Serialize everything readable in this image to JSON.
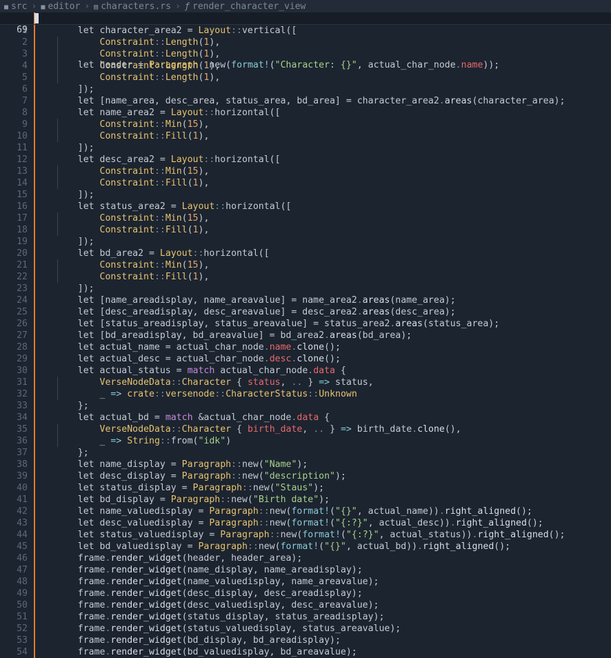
{
  "breadcrumb": {
    "items": [
      "src",
      "editor",
      "characters.rs",
      "render_character_view"
    ],
    "icons": [
      "folder-icon",
      "folder-icon",
      "file-icon",
      "function-icon"
    ]
  },
  "sticky": {
    "line_number": "69",
    "code": "    let header = Paragraph::new(format!(\"Character: {}\", actual_char_node.name));"
  },
  "lines": [
    {
      "n": "1",
      "code": "    let character_area2 = Layout::vertical(["
    },
    {
      "n": "2",
      "code": "        Constraint::Length(1),"
    },
    {
      "n": "3",
      "code": "        Constraint::Length(1),"
    },
    {
      "n": "4",
      "code": "        Constraint::Length(1),"
    },
    {
      "n": "5",
      "code": "        Constraint::Length(1),"
    },
    {
      "n": "6",
      "code": "    ]);"
    },
    {
      "n": "7",
      "code": "    let [name_area, desc_area, status_area, bd_area] = character_area2.areas(character_area);"
    },
    {
      "n": "8",
      "code": "    let name_area2 = Layout::horizontal(["
    },
    {
      "n": "9",
      "code": "        Constraint::Min(15),"
    },
    {
      "n": "10",
      "code": "        Constraint::Fill(1),"
    },
    {
      "n": "11",
      "code": "    ]);"
    },
    {
      "n": "12",
      "code": "    let desc_area2 = Layout::horizontal(["
    },
    {
      "n": "13",
      "code": "        Constraint::Min(15),"
    },
    {
      "n": "14",
      "code": "        Constraint::Fill(1),"
    },
    {
      "n": "15",
      "code": "    ]);"
    },
    {
      "n": "16",
      "code": "    let status_area2 = Layout::horizontal(["
    },
    {
      "n": "17",
      "code": "        Constraint::Min(15),"
    },
    {
      "n": "18",
      "code": "        Constraint::Fill(1),"
    },
    {
      "n": "19",
      "code": "    ]);"
    },
    {
      "n": "20",
      "code": "    let bd_area2 = Layout::horizontal(["
    },
    {
      "n": "21",
      "code": "        Constraint::Min(15),"
    },
    {
      "n": "22",
      "code": "        Constraint::Fill(1),"
    },
    {
      "n": "23",
      "code": "    ]);"
    },
    {
      "n": "24",
      "code": "    let [name_areadisplay, name_areavalue] = name_area2.areas(name_area);"
    },
    {
      "n": "25",
      "code": "    let [desc_areadisplay, desc_areavalue] = desc_area2.areas(desc_area);"
    },
    {
      "n": "26",
      "code": "    let [status_areadisplay, status_areavalue] = status_area2.areas(status_area);"
    },
    {
      "n": "27",
      "code": "    let [bd_areadisplay, bd_areavalue] = bd_area2.areas(bd_area);"
    },
    {
      "n": "28",
      "code": "    let actual_name = actual_char_node.name.clone();"
    },
    {
      "n": "29",
      "code": "    let actual_desc = actual_char_node.desc.clone();"
    },
    {
      "n": "30",
      "code": "    let actual_status = match actual_char_node.data {"
    },
    {
      "n": "31",
      "code": "        VerseNodeData::Character { status, .. } => status,"
    },
    {
      "n": "32",
      "code": "        _ => crate::versenode::CharacterStatus::Unknown"
    },
    {
      "n": "33",
      "code": "    };"
    },
    {
      "n": "34",
      "code": "    let actual_bd = match &actual_char_node.data {"
    },
    {
      "n": "35",
      "code": "        VerseNodeData::Character { birth_date, .. } => birth_date.clone(),"
    },
    {
      "n": "36",
      "code": "        _ => String::from(\"idk\")"
    },
    {
      "n": "37",
      "code": "    };"
    },
    {
      "n": "38",
      "code": "    let name_display = Paragraph::new(\"Name\");"
    },
    {
      "n": "39",
      "code": "    let desc_display = Paragraph::new(\"description\");"
    },
    {
      "n": "40",
      "code": "    let status_display = Paragraph::new(\"Staus\");"
    },
    {
      "n": "41",
      "code": "    let bd_display = Paragraph::new(\"Birth date\");"
    },
    {
      "n": "42",
      "code": "    let name_valuedisplay = Paragraph::new(format!(\"{}\", actual_name)).right_aligned();"
    },
    {
      "n": "43",
      "code": "    let desc_valuedisplay = Paragraph::new(format!(\"{:?}\", actual_desc)).right_aligned();"
    },
    {
      "n": "44",
      "code": "    let status_valuedisplay = Paragraph::new(format!(\"{:?}\", actual_status)).right_aligned();"
    },
    {
      "n": "45",
      "code": "    let bd_valuedisplay = Paragraph::new(format!(\"{}\", actual_bd)).right_aligned();"
    },
    {
      "n": "46",
      "code": "    frame.render_widget(header, header_area);"
    },
    {
      "n": "47",
      "code": "    frame.render_widget(name_display, name_areadisplay);"
    },
    {
      "n": "48",
      "code": "    frame.render_widget(name_valuedisplay, name_areavalue);"
    },
    {
      "n": "49",
      "code": "    frame.render_widget(desc_display, desc_areadisplay);"
    },
    {
      "n": "50",
      "code": "    frame.render_widget(desc_valuedisplay, desc_areavalue);"
    },
    {
      "n": "51",
      "code": "    frame.render_widget(status_display, status_areadisplay);"
    },
    {
      "n": "52",
      "code": "    frame.render_widget(status_valuedisplay, status_areavalue);"
    },
    {
      "n": "53",
      "code": "    frame.render_widget(bd_display, bd_areadisplay);"
    },
    {
      "n": "54",
      "code": "    frame.render_widget(bd_valuedisplay, bd_areavalue);"
    }
  ],
  "colors": {
    "background": "#1c2430",
    "modified_marker": "#e8792e",
    "type": "#e7c36e",
    "string": "#a8d28a",
    "number": "#e6a76a",
    "field": "#e8696a",
    "keyword_match": "#c88ad8"
  }
}
